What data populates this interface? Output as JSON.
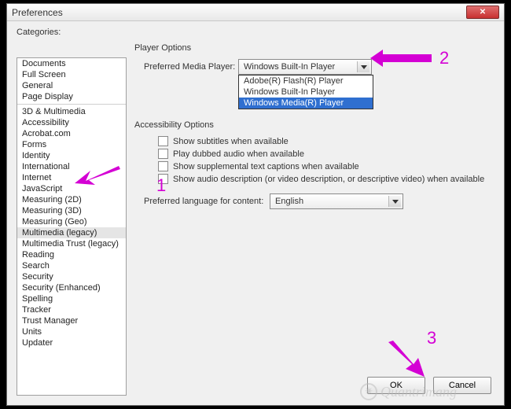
{
  "window": {
    "title": "Preferences"
  },
  "sidebar": {
    "label": "Categories:",
    "group1": [
      "Documents",
      "Full Screen",
      "General",
      "Page Display"
    ],
    "group2": [
      "3D & Multimedia",
      "Accessibility",
      "Acrobat.com",
      "Forms",
      "Identity",
      "International",
      "Internet",
      "JavaScript",
      "Measuring (2D)",
      "Measuring (3D)",
      "Measuring (Geo)",
      "Multimedia (legacy)",
      "Multimedia Trust (legacy)",
      "Reading",
      "Search",
      "Security",
      "Security (Enhanced)",
      "Spelling",
      "Tracker",
      "Trust Manager",
      "Units",
      "Updater"
    ],
    "selected": "Multimedia (legacy)"
  },
  "player_options": {
    "title": "Player Options",
    "pref_label": "Preferred Media Player:",
    "selected": "Windows Built-In Player",
    "options": [
      "Adobe(R) Flash(R) Player",
      "Windows Built-In Player",
      "Windows Media(R) Player"
    ],
    "highlighted_option": "Windows Media(R) Player"
  },
  "accessibility": {
    "title": "Accessibility Options",
    "checks": [
      {
        "label": "Show subtitles when available",
        "checked": false
      },
      {
        "label": "Play dubbed audio when available",
        "checked": false
      },
      {
        "label": "Show supplemental text captions when available",
        "checked": false
      },
      {
        "label": "Show audio description (or video description, or descriptive video) when available",
        "checked": false
      }
    ],
    "lang_label": "Preferred language for content:",
    "lang_value": "English"
  },
  "buttons": {
    "ok": "OK",
    "cancel": "Cancel"
  },
  "annotations": {
    "n1": "1",
    "n2": "2",
    "n3": "3"
  },
  "watermark": "Quantrimang"
}
